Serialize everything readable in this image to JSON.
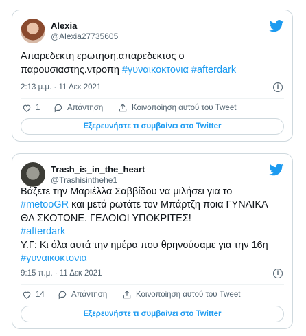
{
  "tweets": [
    {
      "name": "Alexia",
      "handle": "@Alexia27735605",
      "text_line1": "Απαρεδεκτη ερωτηση.απαρεδεκτος ο",
      "text_line2_plain": "παρουσιαστης.ντροπη ",
      "hashtag1": "#γυναικοκτονια",
      "hashtag2": "#afterdark",
      "timestamp": "2:13 μ.μ. · 11 Δεκ 2021",
      "likes": "1",
      "reply_label": "Απάντηση",
      "share_label": "Κοινοποίηση αυτού του Tweet",
      "explore_label": "Εξερευνήστε τι συμβαίνει στο Twitter"
    },
    {
      "name": "Trash_is_in_the_heart",
      "handle": "@Trashisinthehe1",
      "line1": "Βάζετε την Μαριέλλα Σαββίδου να μιλήσει για το",
      "line2_hashtag": "#metooGR",
      "line2_rest": " και μετά ρωτάτε τον Μπάρτζη ποια ΓΥΝΑΙΚΑ",
      "line3": "ΘΑ ΣΚΟΤΩΝΕ. ΓΕΛΟΙΟΙ ΥΠΟΚΡΙΤΕΣ!",
      "line4_hashtag": "#afterdark",
      "line5": "Υ.Γ: Κι όλα αυτά την ημέρα που θρηνούσαμε για την 16η",
      "line6_hashtag": "#γυναικοκτονια",
      "timestamp": "9:15 π.μ. · 11 Δεκ 2021",
      "likes": "14",
      "reply_label": "Απάντηση",
      "share_label": "Κοινοποίηση αυτού του Tweet",
      "explore_label": "Εξερευνήστε τι συμβαίνει στο Twitter"
    }
  ],
  "icons": {
    "bird": "twitter-bird-icon",
    "heart": "heart-icon",
    "reply": "reply-icon",
    "share": "share-icon",
    "info": "info-icon"
  },
  "colors": {
    "accent": "#1d9bf0",
    "muted": "#536471",
    "border": "#cfd9de"
  }
}
